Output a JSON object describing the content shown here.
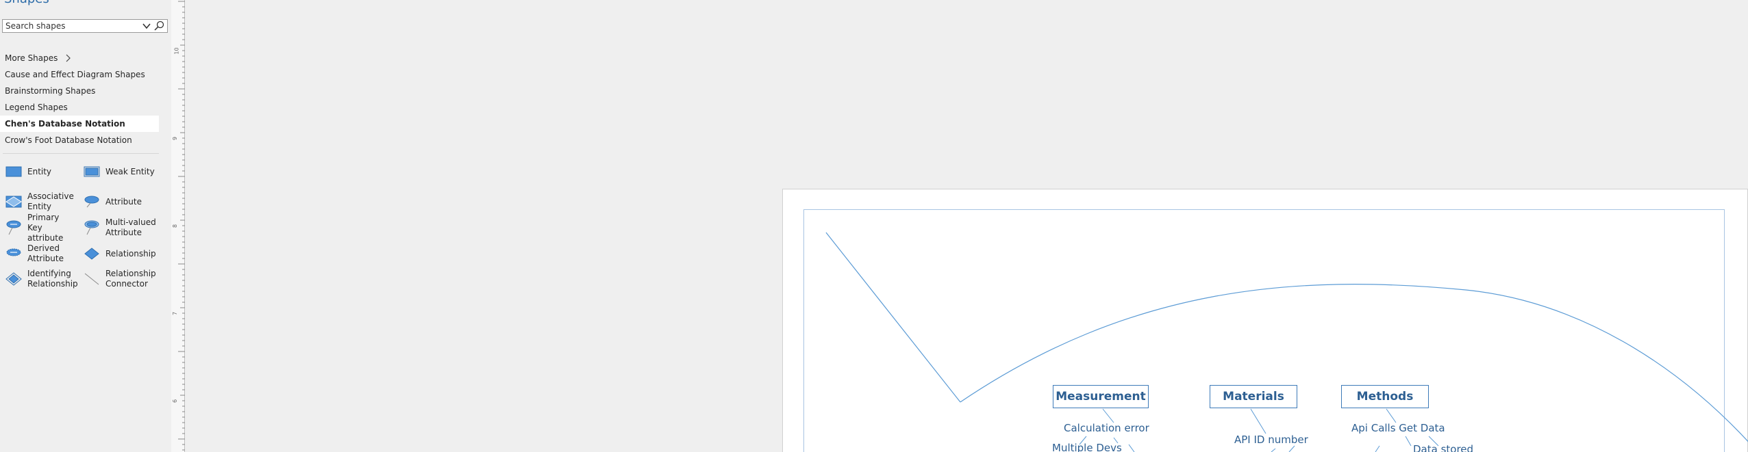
{
  "panel": {
    "title": "Shapes",
    "search": {
      "placeholder": "Search shapes"
    },
    "libraries": [
      {
        "label": "More Shapes"
      },
      {
        "label": "Cause and Effect Diagram Shapes"
      },
      {
        "label": "Brainstorming Shapes"
      },
      {
        "label": "Legend Shapes"
      },
      {
        "label": "Chen's Database Notation",
        "selected": true
      },
      {
        "label": "Crow's Foot Database Notation"
      }
    ],
    "shapes": [
      {
        "label": "Entity",
        "icon": "entity-rect-icon"
      },
      {
        "label": "Weak Entity",
        "icon": "weak-entity-icon"
      },
      {
        "label": "Associative Entity",
        "icon": "associative-entity-icon"
      },
      {
        "label": "Attribute",
        "icon": "attribute-ellipse-icon"
      },
      {
        "label": "Primary Key attribute",
        "icon": "primary-key-icon"
      },
      {
        "label": "Multi-valued Attribute",
        "icon": "multivalued-attribute-icon"
      },
      {
        "label": "Derived Attribute",
        "icon": "derived-attribute-icon"
      },
      {
        "label": "Relationship",
        "icon": "relationship-diamond-icon"
      },
      {
        "label": "Identifying Relationship",
        "icon": "identifying-relationship-icon"
      },
      {
        "label": "Relationship Connector",
        "icon": "connector-line-icon"
      }
    ],
    "accent": "#4a90d9"
  },
  "ruler": {
    "labels": [
      "10",
      "9",
      "8",
      "7",
      "6"
    ]
  },
  "diagram": {
    "categories": [
      {
        "label": "Measurement"
      },
      {
        "label": "Materials"
      },
      {
        "label": "Methods"
      }
    ],
    "causes": [
      {
        "label": "Calculation error"
      },
      {
        "label": "Multiple Devs"
      },
      {
        "label": "API ID number"
      },
      {
        "label": "Api Calls Get Data"
      },
      {
        "label": "Data stored"
      }
    ],
    "line_color": "#5b9bd5",
    "text_color": "#2d5f92"
  }
}
